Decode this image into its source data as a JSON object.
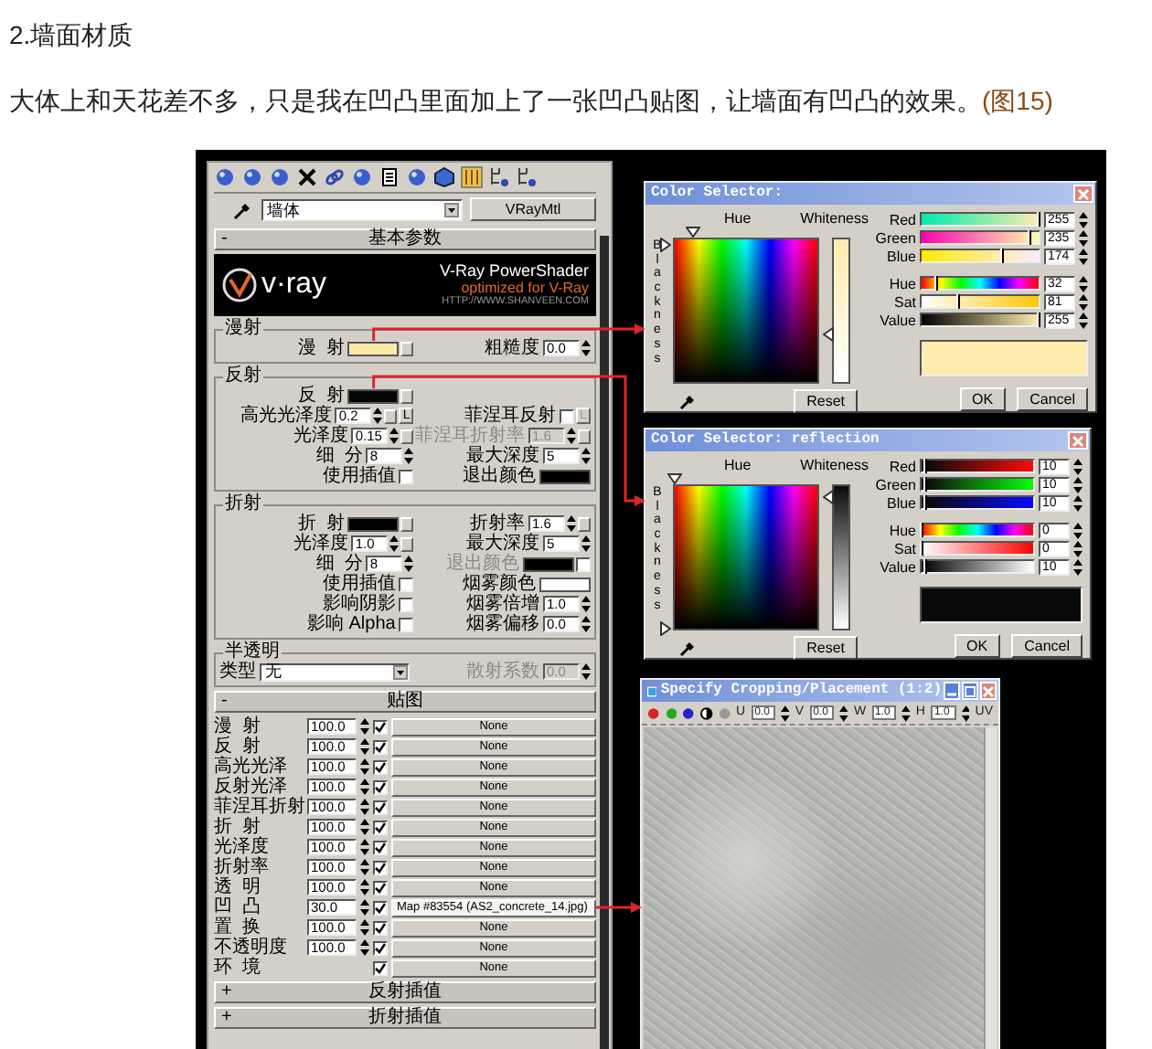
{
  "heading": "2.墙面材质",
  "paragraph": {
    "text": "大体上和天花差不多，只是我在凹凸里面加上了一张凹凸贴图，让墙面有凹凸的效果。",
    "link": "(图15)"
  },
  "material_editor": {
    "material_name": "墙体",
    "material_type": "VRayMtl",
    "basic_rollout": {
      "sign": "-",
      "title": "基本参数"
    },
    "banner": {
      "logo": "v·ray",
      "title": "V-Ray PowerShader",
      "subtitle": "optimized for V-Ray",
      "url": "HTTP://WWW.SHANVEEN.COM"
    },
    "groups": [
      {
        "title": "漫射",
        "rows": [
          [
            {
              "kind": "swatch",
              "label": "漫  射",
              "color": "#fde9a8",
              "map_button": true,
              "disabled": false
            },
            {
              "kind": "spinner",
              "label": "粗糙度",
              "value": "0.0",
              "disabled": false
            }
          ]
        ]
      },
      {
        "title": "反射",
        "rows": [
          [
            {
              "kind": "swatch",
              "label": "反  射",
              "color": "#050505",
              "map_button": true,
              "disabled": false
            },
            null
          ],
          [
            {
              "kind": "spinner",
              "label": "高光光泽度",
              "value": "0.2",
              "disabled": false,
              "map_button": true,
              "button": {
                "label": "L",
                "disabled": false
              }
            },
            {
              "kind": "checkbox",
              "label": "菲涅耳反射",
              "checked": false,
              "disabled": false,
              "button": {
                "label": "L",
                "disabled": true
              }
            }
          ],
          [
            {
              "kind": "spinner",
              "label": "光泽度",
              "value": "0.15",
              "disabled": false,
              "map_button": true
            },
            {
              "kind": "spinner",
              "label": "菲涅耳折射率",
              "value": "1.6",
              "disabled": true,
              "map_button": true
            }
          ],
          [
            {
              "kind": "spinner",
              "label": "细  分",
              "value": "8",
              "disabled": false
            },
            {
              "kind": "spinner",
              "label": "最大深度",
              "value": "5",
              "disabled": false
            }
          ],
          [
            {
              "kind": "checkbox",
              "label": "使用插值",
              "checked": false,
              "disabled": false
            },
            {
              "kind": "swatch",
              "label": "退出颜色",
              "color": "#000000",
              "disabled": false
            }
          ]
        ]
      },
      {
        "title": "折射",
        "rows": [
          [
            {
              "kind": "swatch",
              "label": "折  射",
              "color": "#000000",
              "map_button": true,
              "disabled": false
            },
            {
              "kind": "spinner",
              "label": "折射率",
              "value": "1.6",
              "disabled": false,
              "map_button": true
            }
          ],
          [
            {
              "kind": "spinner",
              "label": "光泽度",
              "value": "1.0",
              "disabled": false,
              "map_button": true
            },
            {
              "kind": "spinner",
              "label": "最大深度",
              "value": "5",
              "disabled": false
            }
          ],
          [
            {
              "kind": "spinner",
              "label": "细  分",
              "value": "8",
              "disabled": false
            },
            {
              "kind": "swatch",
              "label": "退出颜色",
              "color": "#000000",
              "disabled": true,
              "toggle": {
                "checked": false
              }
            }
          ],
          [
            {
              "kind": "checkbox",
              "label": "使用插值",
              "checked": false,
              "disabled": false
            },
            {
              "kind": "swatch",
              "label": "烟雾颜色",
              "color": "#ffffff",
              "disabled": false
            }
          ],
          [
            {
              "kind": "checkbox",
              "label": "影响阴影",
              "checked": false,
              "disabled": false
            },
            {
              "kind": "spinner",
              "label": "烟雾倍增",
              "value": "1.0",
              "disabled": false
            }
          ],
          [
            {
              "kind": "checkbox",
              "label": "影响 Alpha",
              "checked": false,
              "disabled": false
            },
            {
              "kind": "spinner",
              "label": "烟雾偏移",
              "value": "0.0",
              "disabled": false
            }
          ]
        ]
      },
      {
        "title": "半透明",
        "rows": [
          [
            {
              "kind": "dropdown",
              "label": "类型",
              "value": "无",
              "disabled": false
            },
            {
              "kind": "spinner",
              "label": "散射系数",
              "value": "0.0",
              "disabled": true
            }
          ]
        ]
      }
    ],
    "maps_rollout": {
      "sign": "-",
      "title": "贴图"
    },
    "maps": [
      {
        "label": "漫  射",
        "amount": "100.0",
        "checked": true,
        "map": "None"
      },
      {
        "label": "反  射",
        "amount": "100.0",
        "checked": true,
        "map": "None"
      },
      {
        "label": "高光光泽",
        "amount": "100.0",
        "checked": true,
        "map": "None"
      },
      {
        "label": "反射光泽",
        "amount": "100.0",
        "checked": true,
        "map": "None"
      },
      {
        "label": "菲涅耳折射",
        "amount": "100.0",
        "checked": true,
        "map": "None"
      },
      {
        "label": "折  射",
        "amount": "100.0",
        "checked": true,
        "map": "None"
      },
      {
        "label": "光泽度",
        "amount": "100.0",
        "checked": true,
        "map": "None"
      },
      {
        "label": "折射率",
        "amount": "100.0",
        "checked": true,
        "map": "None"
      },
      {
        "label": "透  明",
        "amount": "100.0",
        "checked": true,
        "map": "None"
      },
      {
        "label": "凹  凸",
        "amount": "30.0",
        "checked": true,
        "map": "Map #83554 (AS2_concrete_14.jpg)"
      },
      {
        "label": "置  换",
        "amount": "100.0",
        "checked": true,
        "map": "None"
      },
      {
        "label": "不透明度",
        "amount": "100.0",
        "checked": true,
        "map": "None"
      },
      {
        "label": "环  境",
        "checked": true,
        "map": "None"
      }
    ],
    "closed_rollouts": [
      {
        "sign": "+",
        "title": "反射插值"
      },
      {
        "sign": "+",
        "title": "折射插值"
      }
    ]
  },
  "color_selectors": [
    {
      "title": "Color Selector:",
      "hue_label": "Hue",
      "whiteness_label": "Whiteness",
      "blackness_label": "Blackness",
      "color": "#ffebae",
      "sliders": [
        {
          "kind": "red",
          "label": "Red",
          "value": "255",
          "level": 1
        },
        {
          "kind": "green",
          "label": "Green",
          "value": "235",
          "level": 0.92
        },
        {
          "kind": "blue",
          "label": "Blue",
          "value": "174",
          "level": 0.68
        },
        {
          "kind": "hue",
          "label": "Hue",
          "value": "32",
          "level": 0.13
        },
        {
          "kind": "sat",
          "label": "Sat",
          "value": "81",
          "level": 0.32
        },
        {
          "kind": "value",
          "label": "Value",
          "value": "255",
          "level": 1
        }
      ],
      "buttons": [
        "Reset",
        "OK",
        "Cancel"
      ]
    },
    {
      "title": "Color Selector: reflection",
      "hue_label": "Hue",
      "whiteness_label": "Whiteness",
      "blackness_label": "Blackness",
      "color": "#0a0a0a",
      "sliders": [
        {
          "kind": "red",
          "label": "Red",
          "value": "10",
          "level": 0.04
        },
        {
          "kind": "green",
          "label": "Green",
          "value": "10",
          "level": 0.04
        },
        {
          "kind": "blue",
          "label": "Blue",
          "value": "10",
          "level": 0.04
        },
        {
          "kind": "hue",
          "label": "Hue",
          "value": "0",
          "level": 0
        },
        {
          "kind": "sat",
          "label": "Sat",
          "value": "0",
          "level": 0
        },
        {
          "kind": "value",
          "label": "Value",
          "value": "10",
          "level": 0.04
        }
      ],
      "buttons": [
        "Reset",
        "OK",
        "Cancel"
      ]
    }
  ],
  "crop_window": {
    "title": "Specify Cropping/Placement (1:2)",
    "fields": [
      {
        "label": "U",
        "value": "0.0"
      },
      {
        "label": "V",
        "value": "0.0"
      },
      {
        "label": "W",
        "value": "1.0"
      },
      {
        "label": "H",
        "value": "1.0"
      }
    ],
    "mode": "UV"
  }
}
